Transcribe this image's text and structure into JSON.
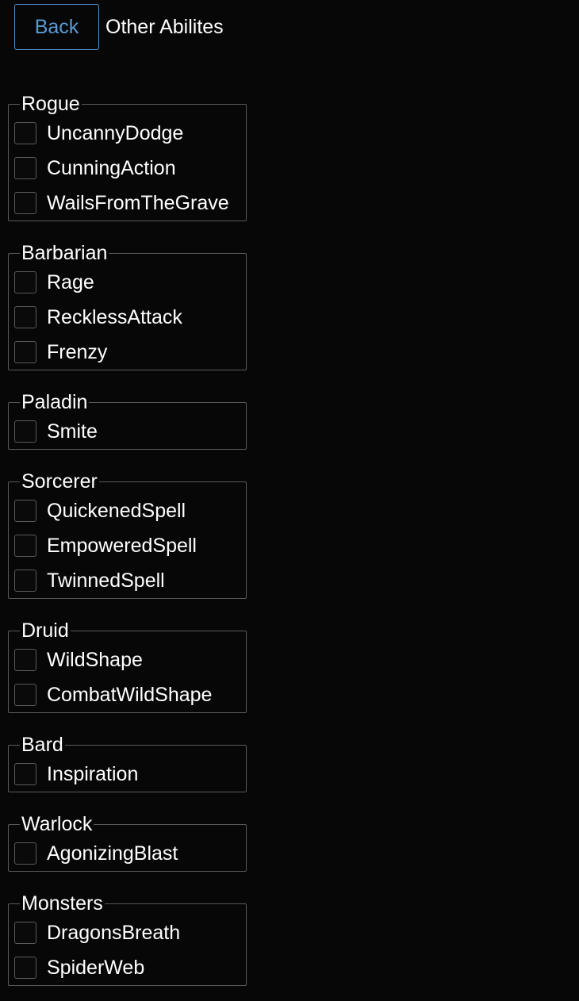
{
  "header": {
    "back_label": "Back",
    "title": "Other Abilites"
  },
  "groups": [
    {
      "legend": "Rogue",
      "items": [
        {
          "label": "UncannyDodge",
          "checked": false
        },
        {
          "label": "CunningAction",
          "checked": false
        },
        {
          "label": "WailsFromTheGrave",
          "checked": false
        }
      ]
    },
    {
      "legend": "Barbarian",
      "items": [
        {
          "label": "Rage",
          "checked": false
        },
        {
          "label": "RecklessAttack",
          "checked": false
        },
        {
          "label": "Frenzy",
          "checked": false
        }
      ]
    },
    {
      "legend": "Paladin",
      "items": [
        {
          "label": "Smite",
          "checked": false
        }
      ]
    },
    {
      "legend": "Sorcerer",
      "items": [
        {
          "label": "QuickenedSpell",
          "checked": false
        },
        {
          "label": "EmpoweredSpell",
          "checked": false
        },
        {
          "label": "TwinnedSpell",
          "checked": false
        }
      ]
    },
    {
      "legend": "Druid",
      "items": [
        {
          "label": "WildShape",
          "checked": false
        },
        {
          "label": "CombatWildShape",
          "checked": false
        }
      ]
    },
    {
      "legend": "Bard",
      "items": [
        {
          "label": "Inspiration",
          "checked": false
        }
      ]
    },
    {
      "legend": "Warlock",
      "items": [
        {
          "label": "AgonizingBlast",
          "checked": false
        }
      ]
    },
    {
      "legend": "Monsters",
      "items": [
        {
          "label": "DragonsBreath",
          "checked": false
        },
        {
          "label": "SpiderWeb",
          "checked": false
        }
      ]
    }
  ],
  "colors": {
    "background": "#070707",
    "accent": "#5a9bd5",
    "border": "#5a5a5a",
    "text": "#ffffff"
  }
}
